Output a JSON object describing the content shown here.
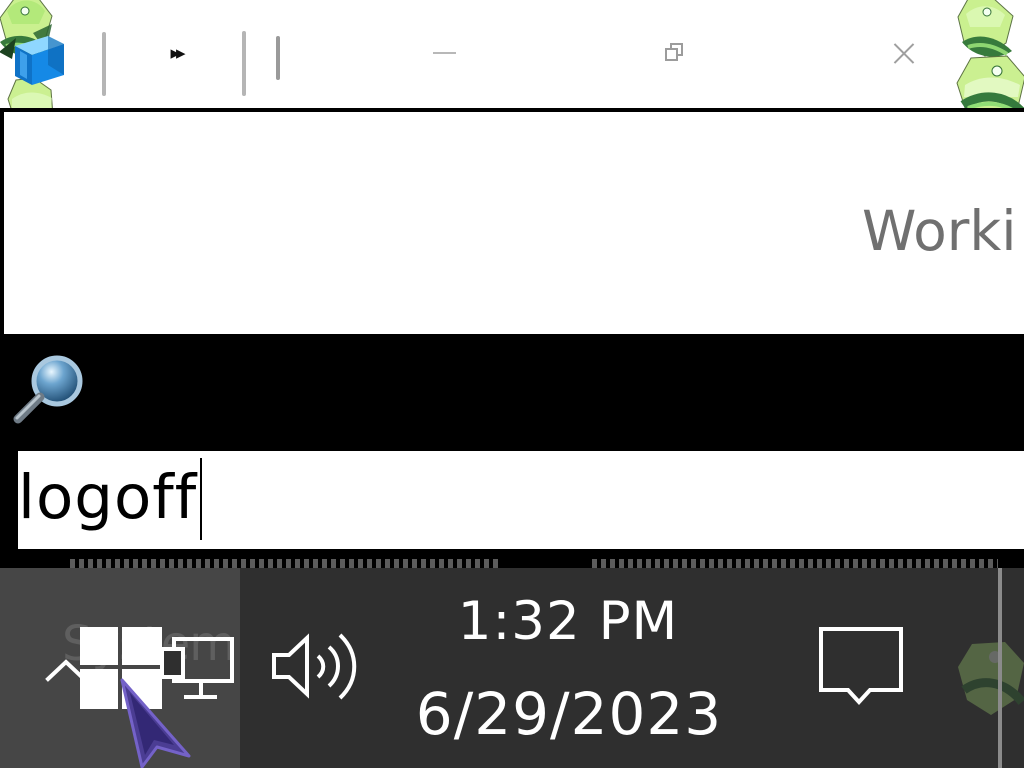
{
  "window": {
    "toolbar": {
      "fast_forward_symbol": "▸▸",
      "minimize_label": "",
      "maximize_label": "",
      "close_label": ""
    },
    "message": {
      "visible_text": "Worki"
    },
    "command": {
      "value": "logoff",
      "placeholder": ""
    }
  },
  "taskbar": {
    "faint_start_text": "System",
    "tray": {
      "clock_time": "1:32 PM",
      "clock_date": "6/29/2023"
    }
  },
  "icons": {
    "app": "taskbar-app-icon",
    "search": "magnifier-icon",
    "windows": "windows-logo-icon",
    "network": "network-icon",
    "volume": "volume-icon",
    "notification": "notification-icon",
    "pointer": "mouse-pointer-icon",
    "sticker": "gem-character-sticker"
  },
  "colors": {
    "taskbar": "#2f2f2f",
    "taskbar_active": "#464646",
    "command_background": "#ffffff",
    "command_text": "#000000",
    "message_text": "#707070",
    "tray_text": "#ffffff",
    "pointer_fill": "#4b3d93",
    "sticker_green": "#b6ef7a"
  }
}
